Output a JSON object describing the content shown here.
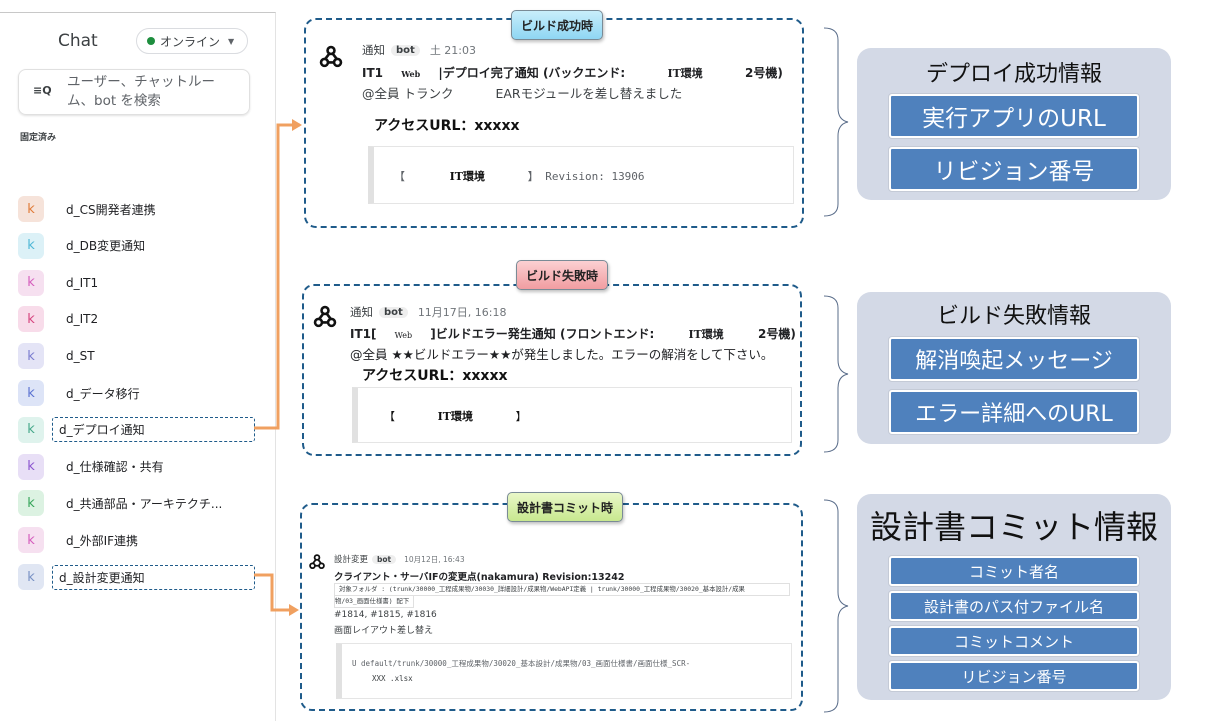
{
  "sidebar": {
    "title": "Chat",
    "status": "オンライン",
    "status_color": "#1e8e3e",
    "search_placeholder": "ユーザー、チャットルーム、bot を検索",
    "pinned_label": "固定済み",
    "rooms": [
      {
        "initial": "k",
        "name": "d_CS開発者連携",
        "bg": "#f6e3da",
        "fg": "#e07b39"
      },
      {
        "initial": "k",
        "name": "d_DB変更通知",
        "bg": "#dcf1f7",
        "fg": "#4fb7d6"
      },
      {
        "initial": "k",
        "name": "d_IT1",
        "bg": "#f6e0f0",
        "fg": "#d45dbd"
      },
      {
        "initial": "k",
        "name": "d_IT2",
        "bg": "#f8dcea",
        "fg": "#d6457f"
      },
      {
        "initial": "k",
        "name": "d_ST",
        "bg": "#e4e4f6",
        "fg": "#7a7ccf"
      },
      {
        "initial": "k",
        "name": "d_データ移行",
        "bg": "#dde4f7",
        "fg": "#5a72d1"
      },
      {
        "initial": "k",
        "name": "d_デプロイ通知",
        "bg": "#dff3ed",
        "fg": "#46a88a",
        "highlighted": true
      },
      {
        "initial": "k",
        "name": "d_仕様確認・共有",
        "bg": "#e8dff6",
        "fg": "#8b55cf"
      },
      {
        "initial": "k",
        "name": "d_共通部品・アーキテクチ...",
        "bg": "#dcf2e2",
        "fg": "#36a55a"
      },
      {
        "initial": "k",
        "name": "d_外部IF連携",
        "bg": "#f6e0f0",
        "fg": "#d45dbd"
      },
      {
        "initial": "k",
        "name": "d_設計変更通知",
        "bg": "#e0e6f3",
        "fg": "#7891c4",
        "highlighted": true
      }
    ]
  },
  "panels": {
    "success": {
      "callout": "ビルド成功時",
      "sender": "通知",
      "bot": "bot",
      "time": "土 21:03",
      "title_prefix": "IT1",
      "web": "Web",
      "title_main": "|デプロイ完了通知 (バックエンド:",
      "env": "IT環境",
      "machine": "2号機)",
      "body_mention": "@全員 トランク",
      "body_text": "EARモジュールを差し替えました",
      "access_url": "アクセスURL：xxxxx",
      "code_open": "【",
      "code_env": "IT環境",
      "code_rest": "】 Revision: 13906"
    },
    "failure": {
      "callout": "ビルド失敗時",
      "sender": "通知",
      "bot": "bot",
      "time": "11月17日, 16:18",
      "title_prefix": "IT1[",
      "web": "Web",
      "title_main": "]ビルドエラー発生通知 (フロントエンド:",
      "env": "IT環境",
      "machine": "2号機)",
      "body_text": "@全員 ★★ビルドエラー★★が発生しました。エラーの解消をして下さい。",
      "access_url": "アクセスURL：xxxxx",
      "code_open": "【",
      "code_env": "IT環境",
      "code_close": "】"
    },
    "commit": {
      "callout": "設計書コミット時",
      "sender": "設計変更",
      "bot": "bot",
      "time": "10月12日, 16:43",
      "title": "クライアント・サーバIFの変更点(nakamura) Revision:13242",
      "folder_line1": "対象フォルダ : (trunk/30000_工程成果物/30030_詳細設計/成果物/WebAPI定義 | trunk/30000_工程成果物/30020_基本設計/成果",
      "folder_line2": "物/03_画面仕様書) 配下",
      "tickets": "#1814, #1815, #1816",
      "comment": "画面レイアウト差し替え",
      "code_line1": "U   default/trunk/30000_工程成果物/30020_基本設計/成果物/03_画面仕様書/画面仕様_SCR-",
      "code_line2": "XXX  .xlsx"
    }
  },
  "info_boxes": [
    {
      "title": "デプロイ成功情報",
      "items": [
        "実行アプリのURL",
        "リビジョン番号"
      ]
    },
    {
      "title": "ビルド失敗情報",
      "items": [
        "解消喚起メッセージ",
        "エラー詳細へのURL"
      ]
    },
    {
      "title": "設計書コミット情報",
      "items": [
        "コミット者名",
        "設計書のパス付ファイル名",
        "コミットコメント",
        "リビジョン番号"
      ]
    }
  ],
  "colors": {
    "panel_border": "#1f5b8a",
    "arrow": "#f0a060",
    "info_item": "#4f81bd",
    "info_box": "#d3d9e6"
  }
}
